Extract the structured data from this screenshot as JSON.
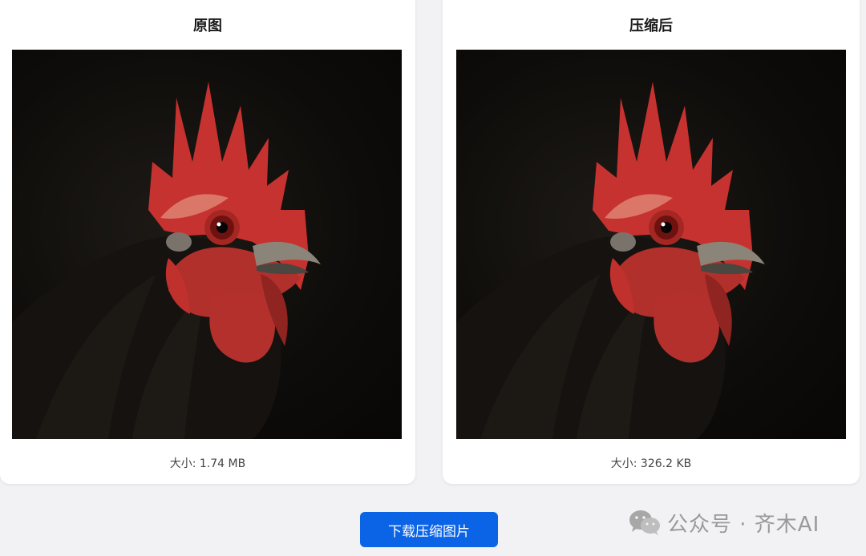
{
  "original": {
    "title": "原图",
    "size_label": "大小: 1.74 MB",
    "image": "rooster-portrait-original"
  },
  "compressed": {
    "title": "压缩后",
    "size_label": "大小: 326.2 KB",
    "image": "rooster-portrait-compressed"
  },
  "actions": {
    "download_label": "下载压缩图片"
  },
  "watermark": {
    "text": "公众号 · 齐木AI",
    "icon": "wechat-icon"
  },
  "colors": {
    "accent": "#0b63e5",
    "background": "#f2f2f4",
    "card": "#ffffff"
  }
}
